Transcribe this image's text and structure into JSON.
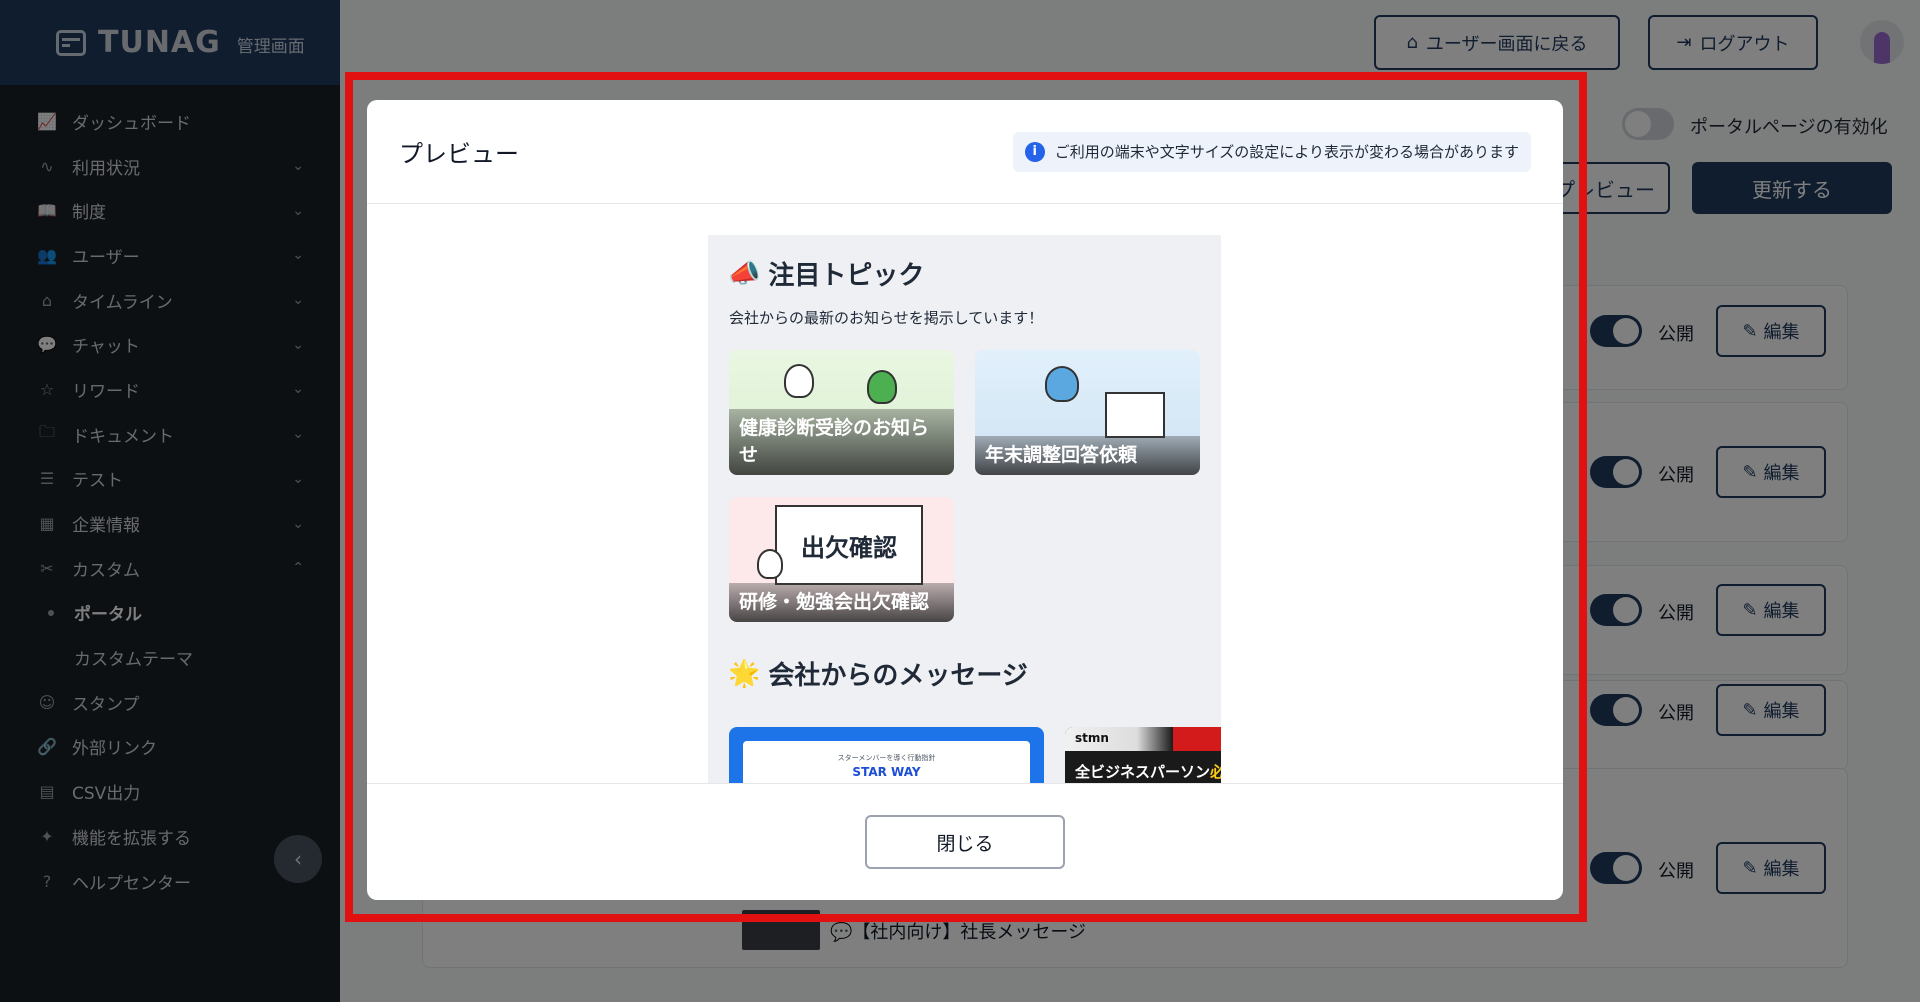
{
  "brand": {
    "name": "TUNAG",
    "sub": "管理画面"
  },
  "sidebar": {
    "items": [
      {
        "label": "ダッシュボード",
        "icon": "chart-icon",
        "chevron": ""
      },
      {
        "label": "利用状況",
        "icon": "pulse-icon",
        "chevron": "⌄"
      },
      {
        "label": "制度",
        "icon": "book-icon",
        "chevron": "⌄"
      },
      {
        "label": "ユーザー",
        "icon": "users-icon",
        "chevron": "⌄"
      },
      {
        "label": "タイムライン",
        "icon": "home-icon",
        "chevron": "⌄"
      },
      {
        "label": "チャット",
        "icon": "chat-icon",
        "chevron": "⌄"
      },
      {
        "label": "リワード",
        "icon": "star-icon",
        "chevron": "⌄"
      },
      {
        "label": "ドキュメント",
        "icon": "folder-icon",
        "chevron": "⌄"
      },
      {
        "label": "テスト",
        "icon": "list-icon",
        "chevron": "⌄"
      },
      {
        "label": "企業情報",
        "icon": "building-icon",
        "chevron": "⌄"
      },
      {
        "label": "カスタム",
        "icon": "tools-icon",
        "chevron": "⌃"
      }
    ],
    "sub_active": "ポータル",
    "sub_other": "カスタムテーマ",
    "items2": [
      {
        "label": "スタンプ",
        "icon": "smile-icon"
      },
      {
        "label": "外部リンク",
        "icon": "link-icon"
      },
      {
        "label": "CSV出力",
        "icon": "table-icon"
      },
      {
        "label": "機能を拡張する",
        "icon": "sparkle-icon"
      },
      {
        "label": "ヘルプセンター",
        "icon": "help-icon"
      }
    ]
  },
  "header": {
    "user_screen_button": "ユーザー画面に戻る",
    "logout_button": "ログアウト"
  },
  "page": {
    "portal_toggle_label": "ポータルページの有効化",
    "preview_button": "プレビュー",
    "update_button": "更新する",
    "public_label": "公開",
    "edit_label": "編集",
    "bg_row_text": "💬【社内向け】社長メッセージ"
  },
  "modal": {
    "title": "プレビュー",
    "info": "ご利用の端末や文字サイズの設定により表示が変わる場合があります",
    "close_button": "閉じる",
    "section1_title": "注目トピック",
    "section1_desc": "会社からの最新のお知らせを掲示しています！",
    "tiles": [
      "健康診断受診のお知らせ",
      "年末調整回答依頼",
      "研修・勉強会出欠確認"
    ],
    "tile3_sign": "出欠確認",
    "section2_title": "会社からのメッセージ",
    "msg1_small": "スターメンバーを導く行動指針",
    "msg1_title": "STAR WAY",
    "msg2_brand": "stmn",
    "msg2_text": "全ビジネスパーソン",
    "msg2_accent": "必"
  },
  "colors": {
    "accent": "#1e3a5f",
    "highlight": "#e11111",
    "sidebar": "#1b2027"
  }
}
